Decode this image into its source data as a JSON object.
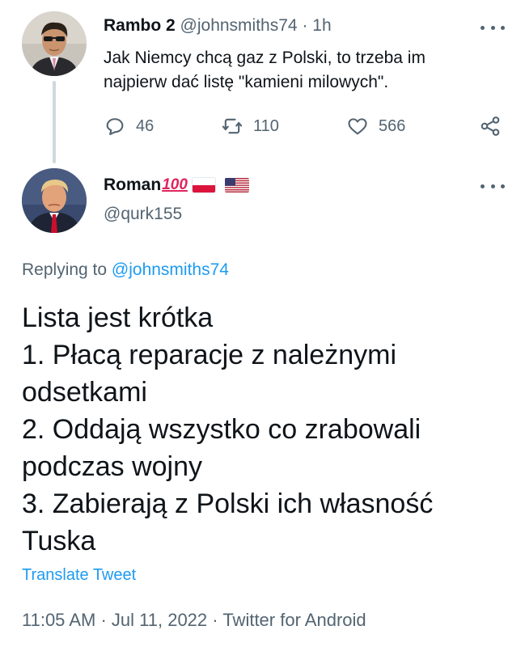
{
  "parent_tweet": {
    "display_name": "Rambo 2",
    "handle": "@johnsmiths74",
    "separator": "·",
    "time": "1h",
    "text_lines": [
      "Jak Niemcy chcą gaz z Polski, to trzeba im",
      "najpierw dać listę \"kamieni milowych\"."
    ],
    "reply_count": "46",
    "retweet_count": "110",
    "like_count": "566",
    "icons": {
      "reply": "reply-bubble-icon",
      "retweet": "retweet-icon",
      "like": "heart-icon",
      "share": "share-icon",
      "more": "more-dots-icon"
    }
  },
  "reply_tweet": {
    "display_name": "Roman",
    "name_emoji": "100",
    "flags": [
      "poland-flag-icon",
      "us-flag-icon"
    ],
    "handle": "@qurk155",
    "replying_prefix": "Replying to",
    "replying_to": "@johnsmiths74",
    "text_lines": [
      "Lista jest krótka",
      "1. Płacą reparacje z należnymi",
      "odsetkami",
      "2. Oddają wszystko co zrabowali",
      "podczas wojny",
      "3. Zabierają z Polski ich własność",
      "Tuska"
    ],
    "translate_label": "Translate Tweet",
    "meta": {
      "time": "11:05 AM",
      "date": "Jul 11, 2022",
      "source": "Twitter for Android",
      "separator": "·"
    }
  },
  "colors": {
    "text": "#0f1419",
    "secondary": "#536471",
    "link": "#1d9bf0",
    "thread_line": "#cfd9de"
  }
}
